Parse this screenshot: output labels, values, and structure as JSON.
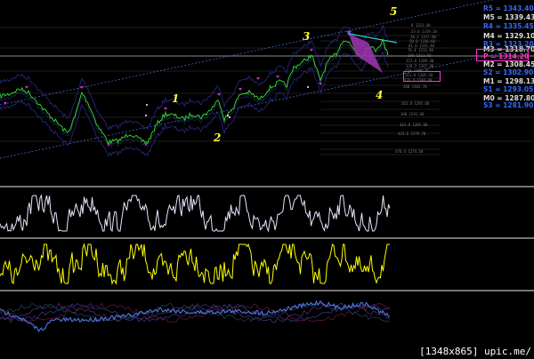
{
  "colors": {
    "background": "#000000",
    "price": "#33cc33",
    "band": "#2a2a88",
    "channel": "#4477dd",
    "pattern": "#9933aa",
    "pattern_edge": "#33cccc",
    "osc1": "#e6e6ff",
    "osc2": "#ffff00",
    "osc3": "#4d7ae6",
    "wave_label": "#ffff33",
    "highlight_box": "#ff33cc",
    "separator": "#bbbbbb"
  },
  "wave_labels": [
    "1",
    "2",
    "3",
    "4",
    "5"
  ],
  "pivot_levels": [
    {
      "label": "R5 = 1343.40",
      "color": "#3366ff"
    },
    {
      "label": "M5 = 1339.43",
      "color": "#dddddd"
    },
    {
      "label": "R4 = 1335.45",
      "color": "#3366ff"
    },
    {
      "label": "M4 = 1329.10",
      "color": "#dddddd"
    },
    {
      "label": "R3 = 1323.20",
      "color": "#3366ff"
    },
    {
      "label": "M3 = 1318.70",
      "color": "#dddddd"
    },
    {
      "label": "P = 1314.20",
      "color": "#ff33cc"
    },
    {
      "label": "M2 = 1308.45",
      "color": "#dddddd"
    },
    {
      "label": "S2 = 1302.90",
      "color": "#3366ff"
    },
    {
      "label": "M1 = 1298.13",
      "color": "#dddddd"
    },
    {
      "label": "S1 = 1293.05",
      "color": "#3366ff"
    },
    {
      "label": "M0 = 1287.80",
      "color": "#dddddd"
    },
    {
      "label": "S3 = 1281.90",
      "color": "#3366ff"
    }
  ],
  "fib_labels": [
    "0 1321.48",
    "23.6 1319.20",
    "38.2 1317.80",
    "50.0 1316.60",
    "61.8 1315.40",
    "76.4 1313.90",
    "100 1311.60",
    "123.6 1309.30",
    "138.2 1307.90",
    "150 1306.70",
    "161.8 1305.50",
    "176.4 1304.00",
    "200 1301.70",
    "261.8 1295.60",
    "300 1291.90",
    "361.8 1285.80",
    "423.6 1279.70",
    "476.4 1274.50"
  ],
  "caption": "[1348x865] upic.me/"
}
